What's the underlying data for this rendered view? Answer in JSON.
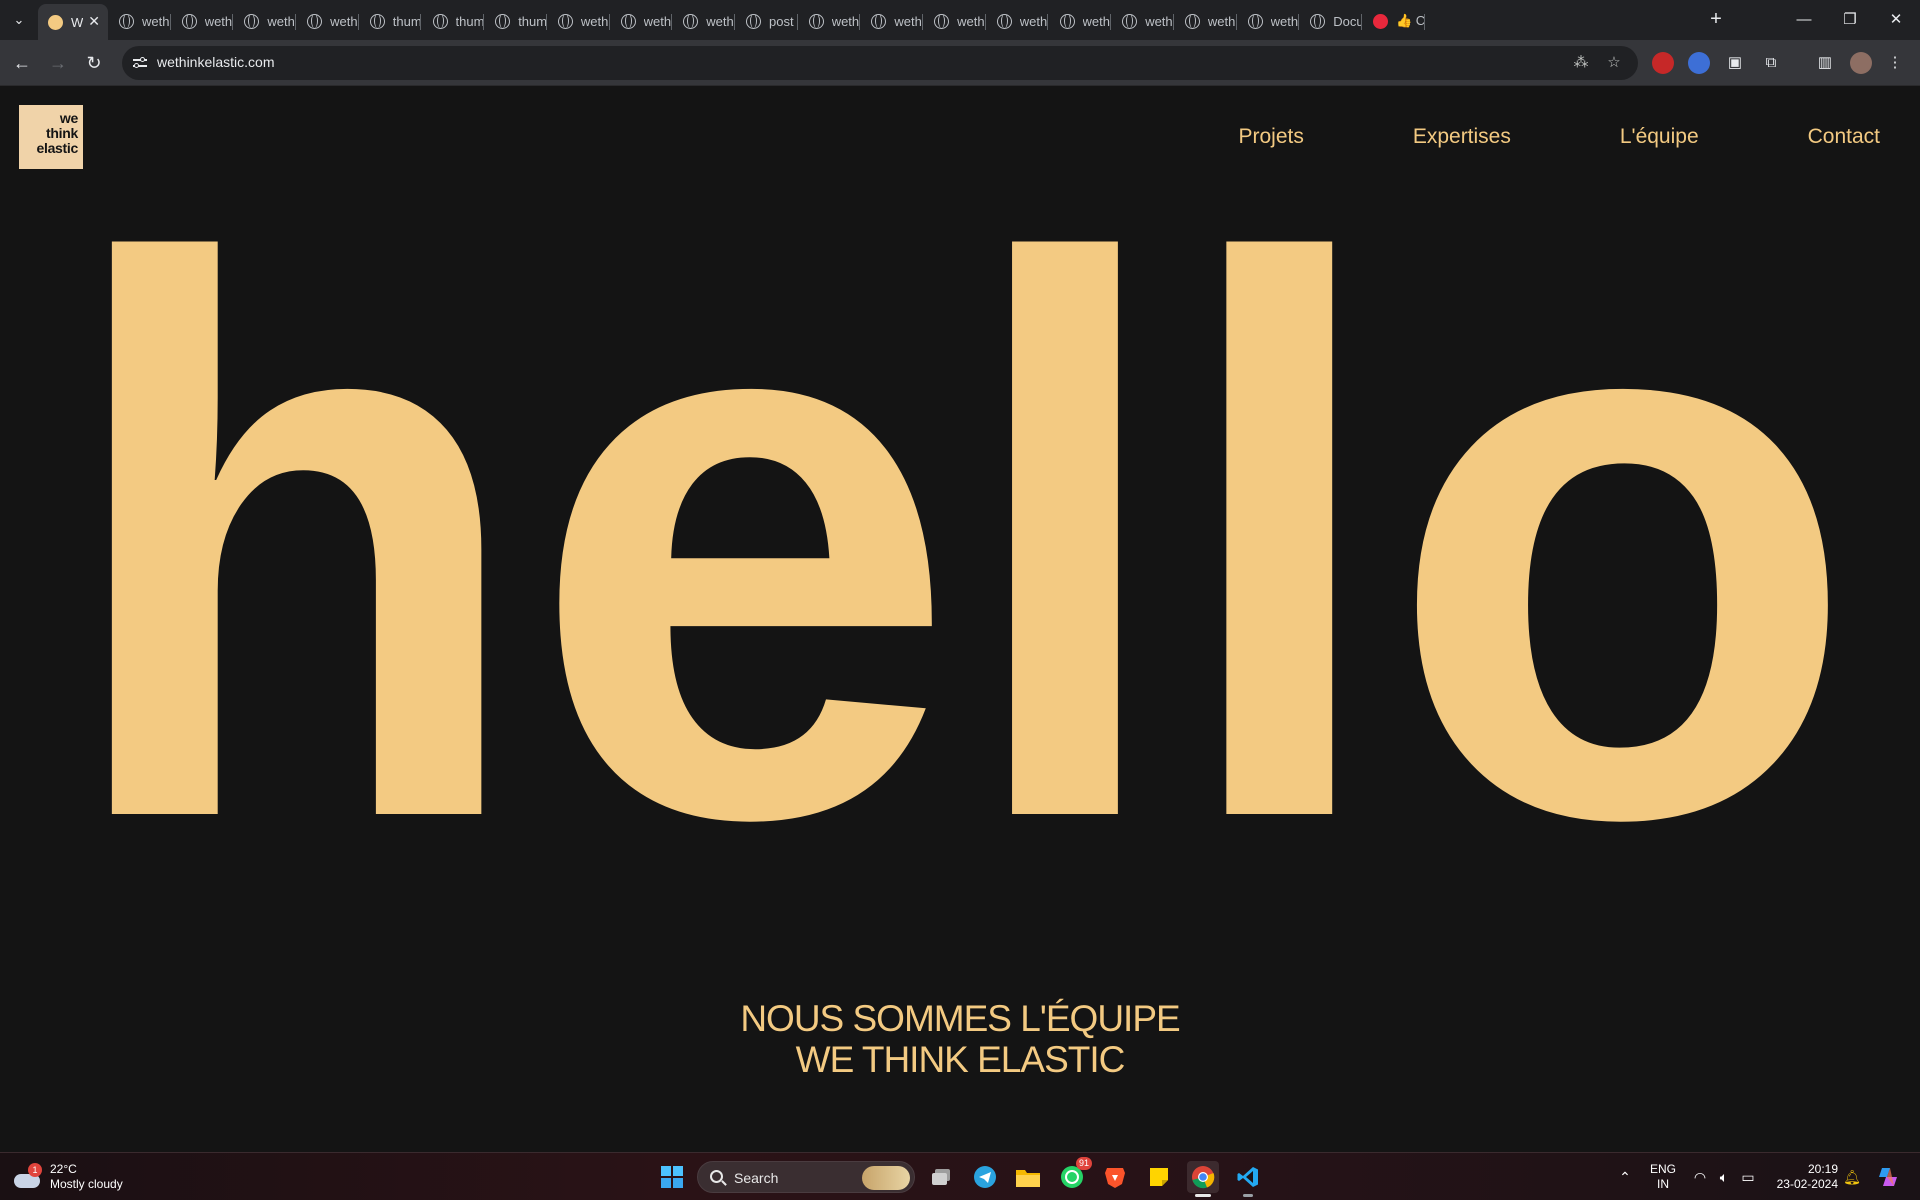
{
  "browser": {
    "tabs": [
      {
        "label": "W",
        "favicon": "wte-logo",
        "active": true
      },
      {
        "label": "weth",
        "favicon": "globe"
      },
      {
        "label": "weth",
        "favicon": "globe"
      },
      {
        "label": "weth",
        "favicon": "globe"
      },
      {
        "label": "weth",
        "favicon": "globe"
      },
      {
        "label": "thum",
        "favicon": "globe"
      },
      {
        "label": "thum",
        "favicon": "globe"
      },
      {
        "label": "thum",
        "favicon": "globe"
      },
      {
        "label": "weth",
        "favicon": "globe"
      },
      {
        "label": "weth",
        "favicon": "globe"
      },
      {
        "label": "weth",
        "favicon": "globe"
      },
      {
        "label": "post",
        "favicon": "globe"
      },
      {
        "label": "weth",
        "favicon": "globe"
      },
      {
        "label": "weth",
        "favicon": "globe"
      },
      {
        "label": "weth",
        "favicon": "globe"
      },
      {
        "label": "weth",
        "favicon": "globe"
      },
      {
        "label": "weth",
        "favicon": "globe"
      },
      {
        "label": "weth",
        "favicon": "globe"
      },
      {
        "label": "weth",
        "favicon": "globe"
      },
      {
        "label": "weth",
        "favicon": "globe"
      },
      {
        "label": "Docu",
        "favicon": "globe"
      },
      {
        "label": "👍 C",
        "favicon": "red-app"
      }
    ],
    "url": "wethinkelastic.com",
    "accent": "#f3ca82"
  },
  "site": {
    "logo": {
      "line1": "we",
      "line2": "think",
      "line3": "elastic"
    },
    "nav": {
      "projets": "Projets",
      "expertises": "Expertises",
      "equipe": "L'équipe",
      "contact": "Contact"
    },
    "hero_word": "hello",
    "tagline": {
      "line1": "NOUS SOMMES L'ÉQUIPE",
      "line2": "WE THINK ELASTIC"
    },
    "colors": {
      "background": "#141414",
      "accent": "#f3ca82"
    }
  },
  "taskbar": {
    "weather": {
      "temp": "22°C",
      "condition": "Mostly cloudy",
      "badge": "1"
    },
    "search_label": "Search",
    "whatsapp_badge": "91",
    "lang": {
      "line1": "ENG",
      "line2": "IN"
    },
    "clock": {
      "time": "20:19",
      "date": "23-02-2024"
    }
  }
}
